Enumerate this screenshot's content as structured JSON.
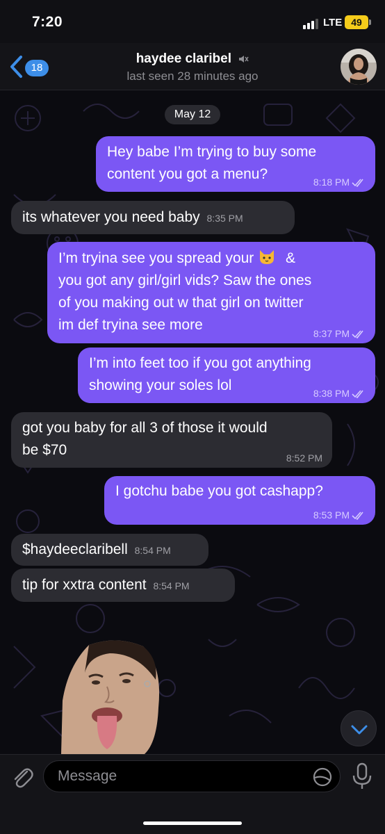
{
  "status_bar": {
    "time": "7:20",
    "network": "LTE",
    "battery": "49"
  },
  "header": {
    "back_count": "18",
    "contact_name": "haydee claribel",
    "last_seen": "last seen 28 minutes ago"
  },
  "date_separator": "May 12",
  "messages": [
    {
      "direction": "out",
      "lines": [
        "Hey babe I’m trying to buy some",
        "content you got a menu?"
      ],
      "time": "8:18 PM",
      "read": true
    },
    {
      "direction": "in",
      "text": "its whatever you need baby",
      "time": "8:35 PM"
    },
    {
      "direction": "out",
      "line1_before": "I’m tryina see you spread your",
      "line1_after": "&",
      "emoji": "cat-face-emoji",
      "lines_rest": [
        "you got any girl/girl vids? Saw the ones",
        "of you making out w that girl on twitter",
        "im def tryina see more"
      ],
      "time": "8:37 PM",
      "read": true
    },
    {
      "direction": "out",
      "lines": [
        "I’m into feet too if you got anything",
        "showing your soles lol"
      ],
      "time": "8:38 PM",
      "read": true
    },
    {
      "direction": "in",
      "lines": [
        "got you baby for all 3 of those it would",
        "be $70"
      ],
      "time": "8:52 PM"
    },
    {
      "direction": "out",
      "text": "I gotchu babe you got cashapp?",
      "time": "8:53 PM",
      "read": true
    },
    {
      "direction": "in",
      "text": "$haydeeclaribell",
      "time": "8:54 PM"
    },
    {
      "direction": "in",
      "text": "tip for xxtra content",
      "time": "8:54 PM"
    }
  ],
  "input": {
    "placeholder": "Message"
  },
  "colors": {
    "outgoing_bubble": "#7b57f4",
    "incoming_bubble": "#2c2c32",
    "accent": "#3d8ee8",
    "battery": "#f5cc1b"
  }
}
